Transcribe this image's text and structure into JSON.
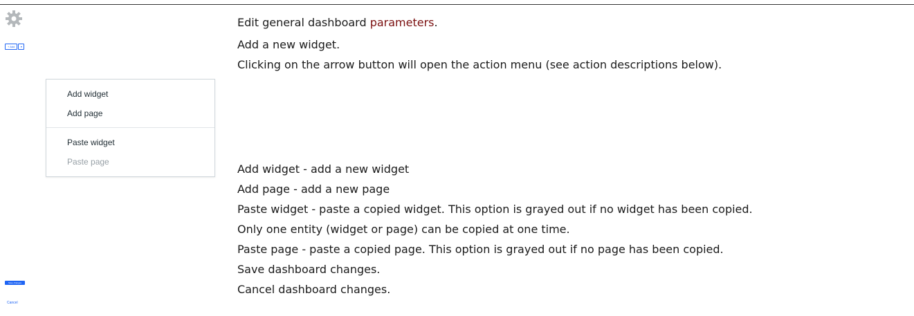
{
  "icons": {
    "gear": "gear-icon",
    "dropdown": "chevron-down-icon"
  },
  "colors": {
    "link": "#7a0f0f",
    "button_blue": "#1f65f4",
    "menu_text": "#1f2c33",
    "menu_disabled": "#969fa5"
  },
  "toolbar": {
    "add_label": "+ Add",
    "save_label": "Save changes",
    "cancel_label": "Cancel"
  },
  "menu": {
    "items": [
      {
        "label": "Add widget",
        "disabled": false
      },
      {
        "label": "Add page",
        "disabled": false
      },
      {
        "label": "Paste widget",
        "disabled": false
      },
      {
        "label": "Paste page",
        "disabled": true
      }
    ]
  },
  "descriptions": {
    "edit_prefix": "Edit general dashboard ",
    "edit_link": "parameters",
    "edit_suffix": ".",
    "add_widget": "Add a new widget.",
    "arrow_hint": "Clicking on the arrow button will open the action menu (see action descriptions below).",
    "menu_add_widget": "Add widget - add a new widget",
    "menu_add_page": "Add page - add a new page",
    "menu_paste_widget": "Paste widget - paste a copied widget. This option is grayed out if no widget has been copied.",
    "menu_one_entity": "Only one entity (widget or page) can be copied at one time.",
    "menu_paste_page": "Paste page - paste a copied page. This option is grayed out if no page has been copied.",
    "save": "Save dashboard changes.",
    "cancel": "Cancel dashboard changes."
  }
}
